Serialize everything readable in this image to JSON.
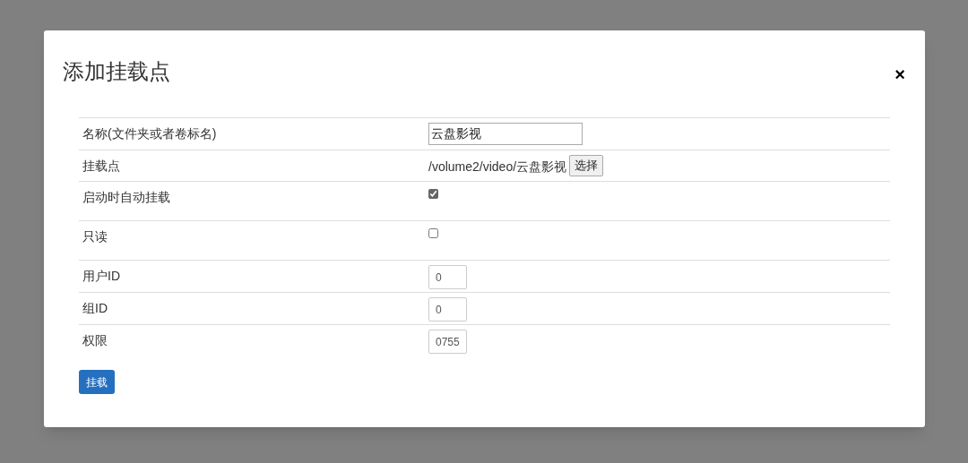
{
  "dialog": {
    "title": "添加挂载点",
    "close": "×"
  },
  "rows": [
    {
      "kind": "text",
      "label": "名称(文件夹或者卷标名)",
      "value": "云盘影视"
    },
    {
      "kind": "path",
      "label": "挂载点",
      "value": "/volume2/video/云盘影视",
      "button": "选择"
    },
    {
      "kind": "checkbox",
      "label": "启动时自动挂载",
      "checked": true
    },
    {
      "kind": "checkbox",
      "label": "只读",
      "checked": false
    },
    {
      "kind": "number",
      "label": "用户ID",
      "value": "0"
    },
    {
      "kind": "number",
      "label": "组ID",
      "value": "0"
    },
    {
      "kind": "number",
      "label": "权限",
      "value": "0755"
    }
  ],
  "submit": "挂载"
}
